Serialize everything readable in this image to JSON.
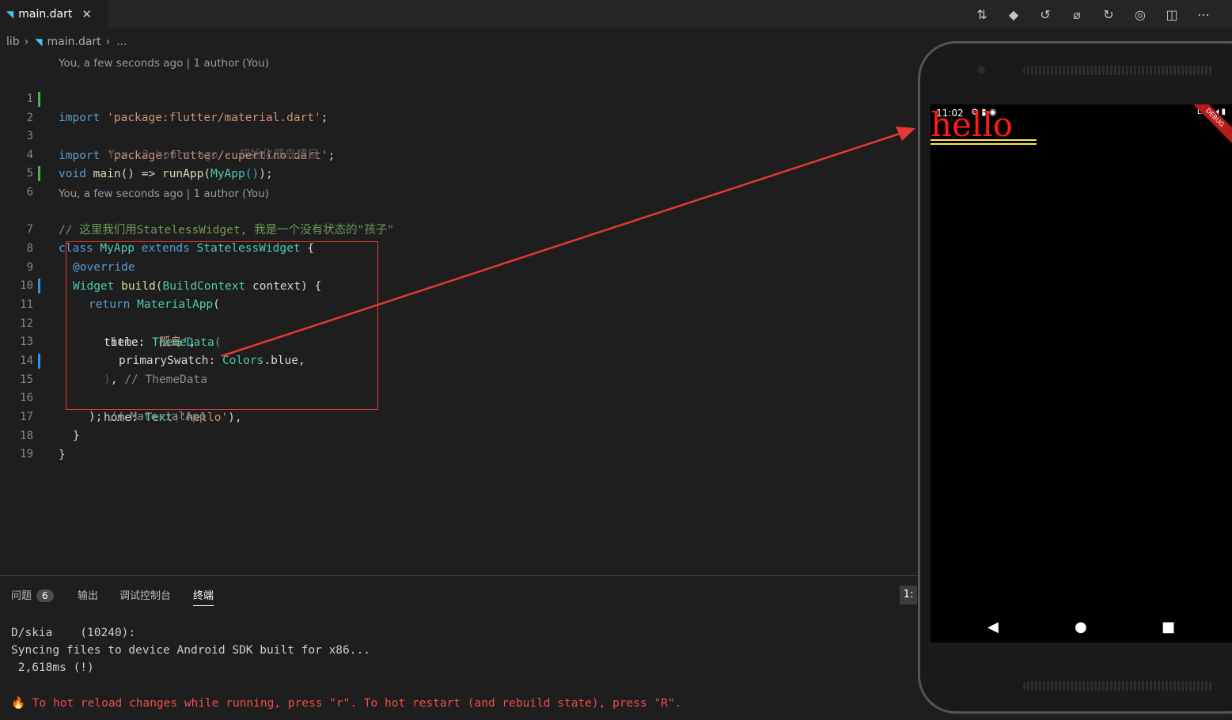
{
  "tab": {
    "icon": "dart-icon",
    "label": "main.dart",
    "close": "✕"
  },
  "toolbar": [
    {
      "name": "compare-changes-icon",
      "glyph": "⇅"
    },
    {
      "name": "git-icon",
      "glyph": "◆"
    },
    {
      "name": "go-back-icon",
      "glyph": "↺"
    },
    {
      "name": "commit-icon",
      "glyph": "⌀"
    },
    {
      "name": "go-forward-icon",
      "glyph": "↻"
    },
    {
      "name": "flutter-outline-icon",
      "glyph": "◎"
    },
    {
      "name": "split-editor-icon",
      "glyph": "◫"
    },
    {
      "name": "more-icon",
      "glyph": "⋯"
    }
  ],
  "breadcrumb": {
    "folder": "lib",
    "file": "main.dart",
    "more": "..."
  },
  "codelens": {
    "top": "You, a few seconds ago | 1 author (You)",
    "class": "You, a few seconds ago | 1 author (You)"
  },
  "code": {
    "l1": {
      "n": "1",
      "kw": "import",
      "str": "'package:flutter/material.dart'",
      "end": ";"
    },
    "l2": {
      "n": "2",
      "kw": "import",
      "str": "'package:flutter/cupertino.dart'",
      "end": ";"
    },
    "l3": {
      "n": "3",
      "blame": "You, 2 hours ago • 初始化孤岛项目"
    },
    "l4": {
      "n": "4",
      "kw": "void",
      "fn": "main",
      "p1": "() => ",
      "fn2": "runApp",
      "p2": "(",
      "cls": "MyApp",
      "p3": "()",
      "end": ");"
    },
    "l5": {
      "n": "5"
    },
    "l6": {
      "n": "6",
      "comment": "// 这里我们用StatelessWidget, 我是一个没有状态的\"孩子\""
    },
    "l7": {
      "n": "7",
      "kw": "class",
      "cls": "MyApp",
      "kw2": "extends",
      "cls2": "StatelessWidget",
      "end": " {"
    },
    "l8": {
      "n": "8",
      "kw": "@override"
    },
    "l9": {
      "n": "9",
      "cls": "Widget",
      "fn": "build",
      "p1": "(",
      "cls2": "BuildContext",
      "pl": " context",
      "end": ") {"
    },
    "l10": {
      "n": "10",
      "kw": "return",
      "cls": "MaterialApp",
      "end": "("
    },
    "l11": {
      "n": "11",
      "pl": "title: ",
      "str": "'孤岛'",
      "end": ","
    },
    "l12": {
      "n": "12",
      "pl": "theme: ",
      "cls": "ThemeData",
      "end": "("
    },
    "l13": {
      "n": "13",
      "pl": "primarySwatch: ",
      "cls": "Colors",
      "end": ".blue,"
    },
    "l14": {
      "n": "14",
      "p": ")",
      "end": ",",
      "comment": "// ThemeData"
    },
    "l15": {
      "n": "15",
      "pl": "home: ",
      "cls": "Text",
      "p1": "(",
      "str": "'hello'",
      "end": "),"
    },
    "l16": {
      "n": "16",
      "end": ");",
      "comment": "// MaterialApp"
    },
    "l17": {
      "n": "17",
      "end": "}"
    },
    "l18": {
      "n": "18",
      "end": "}"
    },
    "l19": {
      "n": "19"
    }
  },
  "panel": {
    "tabs": {
      "problems": "问题",
      "problems_count": "6",
      "output": "输出",
      "debug_console": "调试控制台",
      "terminal": "终端"
    },
    "terminal_select": "1:"
  },
  "terminal": {
    "l1": "D/skia    (10240):",
    "l2": "Syncing files to device Android SDK built for x86...",
    "l3": " 2,618ms (!)",
    "fire": "🔥",
    "l4": "To hot reload changes while running, press \"r\". To hot restart (and rebuild state), press \"R\"."
  },
  "phone": {
    "time": "11:02",
    "status_icons": "⚙ ▮ ◉",
    "network": "LTE ◢ ▮",
    "debug_banner": "DEBUG",
    "app_text": "hello",
    "nav": {
      "back": "◀",
      "home": "●",
      "recents": "■"
    }
  },
  "colors": {
    "editor_bg": "#1e1e1e",
    "keyword": "#569cd6",
    "string": "#ce9178",
    "class": "#4ec9b0",
    "comment": "#6a9955",
    "annotation_red": "#e53935",
    "app_text_red": "#ff1a1a",
    "underline_yellow": "#ffeb3b"
  }
}
